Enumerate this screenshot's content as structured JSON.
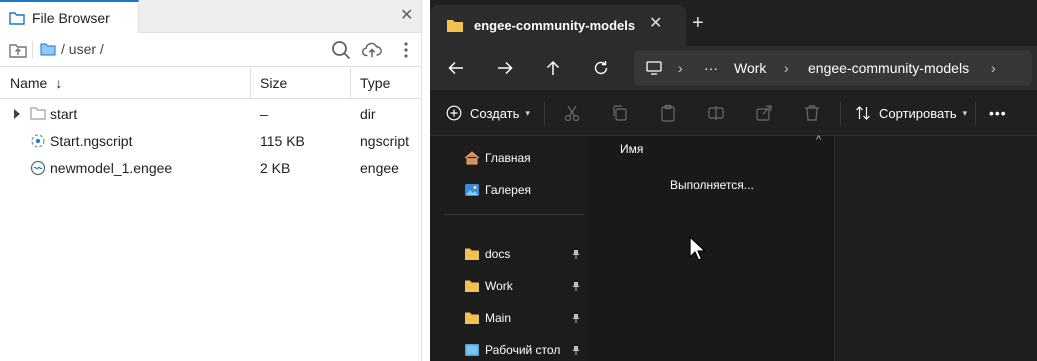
{
  "file_browser": {
    "tab_label": "File Browser",
    "path": "/ user /",
    "columns": {
      "name": "Name",
      "name_sort": "↓",
      "size": "Size",
      "type": "Type"
    },
    "rows": [
      {
        "name": "start",
        "size": "–",
        "type": "dir",
        "icon": "folder-icon",
        "expandable": true
      },
      {
        "name": "Start.ngscript",
        "size": "115 KB",
        "type": "ngscript",
        "icon": "script-file-icon",
        "expandable": false
      },
      {
        "name": "newmodel_1.engee",
        "size": "2 KB",
        "type": "engee",
        "icon": "engee-file-icon",
        "expandable": false
      }
    ]
  },
  "explorer": {
    "tab_label": "engee-community-models",
    "breadcrumb": [
      "Work",
      "engee-community-models"
    ],
    "breadcrumb_more": "···",
    "commands": {
      "new": "Создать",
      "sort": "Сортировать",
      "more": "•••"
    },
    "sidebar": [
      {
        "label": "Главная",
        "icon": "home-icon",
        "pinned": false
      },
      {
        "label": "Галерея",
        "icon": "gallery-icon",
        "pinned": false
      },
      {
        "label": "docs",
        "icon": "folder-icon",
        "pinned": true
      },
      {
        "label": "Work",
        "icon": "folder-icon",
        "pinned": true
      },
      {
        "label": "Main",
        "icon": "folder-icon",
        "pinned": true
      },
      {
        "label": "Рабочий стол",
        "icon": "desktop-icon",
        "pinned": true
      }
    ],
    "content": {
      "column_name": "Имя",
      "status": "Выполняется..."
    }
  },
  "colors": {
    "accent": "#1976d2",
    "dark_bg": "#1c1c1c",
    "folder": "#f2c14e"
  }
}
